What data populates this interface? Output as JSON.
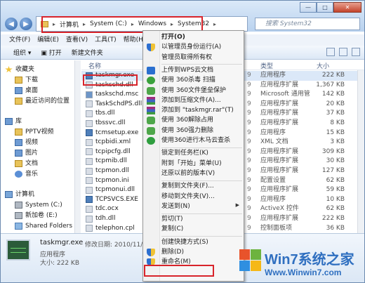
{
  "window": {
    "search_placeholder": "搜索 System32",
    "breadcrumb": [
      "计算机",
      "System (C:)",
      "Windows",
      "System32"
    ]
  },
  "menubar": [
    "文件(F)",
    "编辑(E)",
    "查看(V)",
    "工具(T)",
    "帮助(H)"
  ],
  "toolbar": [
    "组织 ▾",
    "打开",
    "新建文件夹"
  ],
  "nav": {
    "favorites": "收藏夹",
    "fav_items": [
      "下载",
      "桌面",
      "最近访问的位置"
    ],
    "libraries": "库",
    "lib_items": [
      "PPTV视频",
      "视频",
      "图片",
      "文档",
      "音乐"
    ],
    "computer": "计算机",
    "drives": [
      "System (C:)",
      "新加卷 (E:)",
      "Shared Folders"
    ]
  },
  "list": {
    "col_name": "名称",
    "col_type": "类型",
    "col_size": "大小",
    "files": [
      {
        "name": "taskmgr.exe",
        "type": "应用程序",
        "size": "222 KB",
        "num": "9",
        "icon": "exe"
      },
      {
        "name": "taskschd.dll",
        "type": "应用程序扩展",
        "size": "1,367 KB",
        "num": "9",
        "icon": "dll"
      },
      {
        "name": "taskschd.msc",
        "type": "Microsoft 通用管",
        "size": "142 KB",
        "num": "9",
        "icon": "msc"
      },
      {
        "name": "TaskSchdPS.dll",
        "type": "应用程序扩展",
        "size": "20 KB",
        "num": "9",
        "icon": "dll"
      },
      {
        "name": "tbs.dll",
        "type": "应用程序扩展",
        "size": "37 KB",
        "num": "9",
        "icon": "dll"
      },
      {
        "name": "tbssvc.dll",
        "type": "应用程序扩展",
        "size": "8 KB",
        "num": "9",
        "icon": "dll"
      },
      {
        "name": "tcmsetup.exe",
        "type": "应用程序",
        "size": "15 KB",
        "num": "9",
        "icon": "exe"
      },
      {
        "name": "tcpbidi.xml",
        "type": "XML 文档",
        "size": "3 KB",
        "num": "9",
        "icon": "dll"
      },
      {
        "name": "tcpipcfg.dll",
        "type": "应用程序扩展",
        "size": "309 KB",
        "num": "9",
        "icon": "dll"
      },
      {
        "name": "tcpmib.dll",
        "type": "应用程序扩展",
        "size": "30 KB",
        "num": "9",
        "icon": "dll"
      },
      {
        "name": "tcpmon.dll",
        "type": "应用程序扩展",
        "size": "127 KB",
        "num": "9",
        "icon": "dll"
      },
      {
        "name": "tcpmon.ini",
        "type": "配置设置",
        "size": "62 KB",
        "num": "9",
        "icon": "dll"
      },
      {
        "name": "tcpmonui.dll",
        "type": "应用程序扩展",
        "size": "59 KB",
        "num": "9",
        "icon": "dll"
      },
      {
        "name": "TCPSVCS.EXE",
        "type": "应用程序",
        "size": "10 KB",
        "num": "9",
        "icon": "exe"
      },
      {
        "name": "tdc.ocx",
        "type": "ActiveX 控件",
        "size": "62 KB",
        "num": "9",
        "icon": "dll"
      },
      {
        "name": "tdh.dll",
        "type": "应用程序扩展",
        "size": "222 KB",
        "num": "9",
        "icon": "dll"
      },
      {
        "name": "telephon.cpl",
        "type": "控制面板项",
        "size": "36 KB",
        "num": "9",
        "icon": "dll"
      }
    ]
  },
  "context_menu": {
    "items": [
      {
        "label": "打开(O)",
        "bold": true,
        "icon": ""
      },
      {
        "label": "以管理员身份运行(A)",
        "icon": "shield"
      },
      {
        "label": "管理员取得所有权",
        "icon": ""
      },
      {
        "label": "上传到WPS云文档",
        "icon": "wps"
      },
      {
        "label": "使用 360杀毒 扫描",
        "icon": "360"
      },
      {
        "label": "使用 360文件堡垒保护",
        "icon": "360b"
      },
      {
        "label": "添加到压缩文件(A)...",
        "icon": "rar"
      },
      {
        "label": "添加到 \"taskmgr.rar\"(T)",
        "icon": "rar"
      },
      {
        "label": "使用 360解除占用",
        "icon": "360b"
      },
      {
        "label": "使用 360强力删除",
        "icon": "360b"
      },
      {
        "label": "使用360进行木马云查杀",
        "icon": "scan"
      },
      {
        "label": "锁定到任务栏(K)",
        "icon": ""
      },
      {
        "label": "附到「开始」菜单(U)",
        "icon": ""
      },
      {
        "label": "还原以前的版本(V)",
        "icon": ""
      },
      {
        "label": "复制到文件夹(F)...",
        "icon": ""
      },
      {
        "label": "移动到文件夹(V)...",
        "icon": ""
      },
      {
        "label": "发送到(N)",
        "icon": "",
        "submenu": true
      },
      {
        "label": "剪切(T)",
        "icon": ""
      },
      {
        "label": "复制(C)",
        "icon": ""
      },
      {
        "label": "创建快捷方式(S)",
        "icon": ""
      },
      {
        "label": "删除(D)",
        "icon": "shield"
      },
      {
        "label": "重命名(M)",
        "icon": "shield"
      }
    ]
  },
  "status": {
    "name": "taskmgr.exe",
    "modified": "修改日期: 2010/11/21 5:",
    "type": "应用程序",
    "size": "大小: 222 KB"
  },
  "watermark": {
    "title_a": "Win",
    "title_b": "7系统之家",
    "url": "Www.Winwin7.com"
  }
}
